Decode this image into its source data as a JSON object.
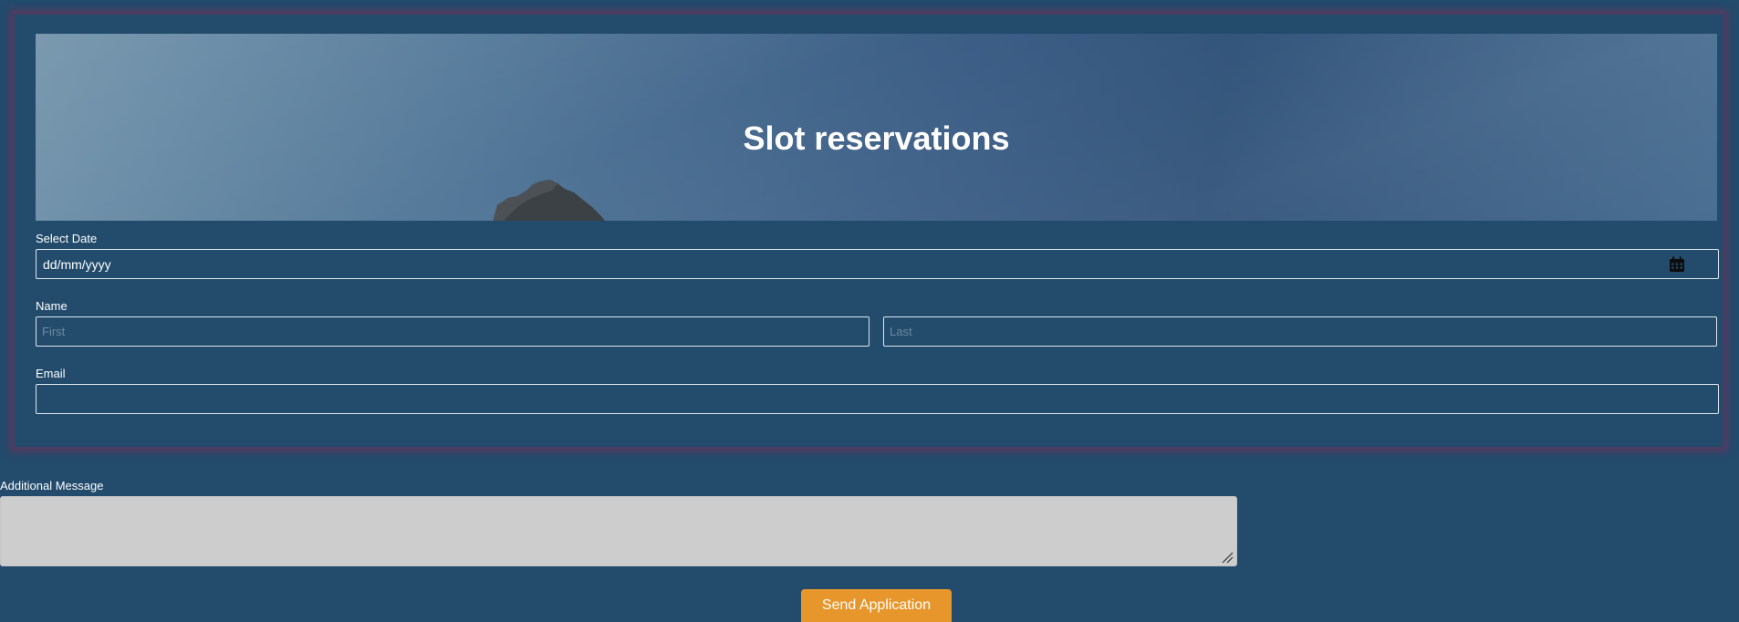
{
  "hero": {
    "title": "Slot reservations"
  },
  "form": {
    "date": {
      "label": "Select Date",
      "value": "dd/mm/yyyy",
      "icon": "calendar-icon"
    },
    "name": {
      "label": "Name",
      "first_placeholder": "First",
      "last_placeholder": "Last"
    },
    "email": {
      "label": "Email",
      "value": ""
    }
  },
  "message": {
    "label": "Additional Message",
    "value": ""
  },
  "submit": {
    "label": "Send Application",
    "color": "#e7962b"
  },
  "colors": {
    "background": "#224b6c",
    "card_border": "#4a3c62",
    "textarea_bg": "#cdcdcd"
  }
}
